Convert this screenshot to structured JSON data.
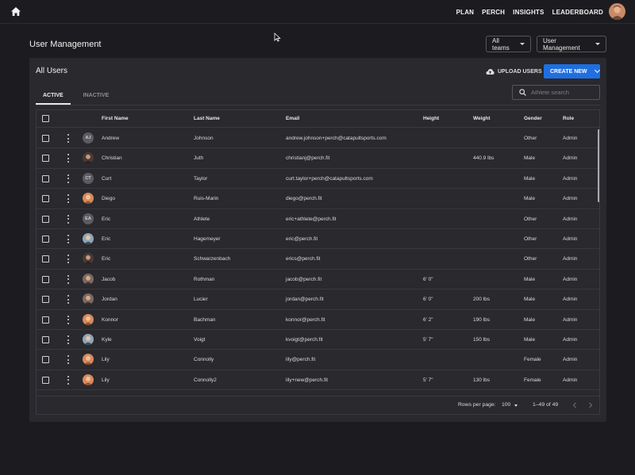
{
  "topbar": {
    "nav": [
      "PLAN",
      "PERCH",
      "INSIGHTS",
      "LEADERBOARD"
    ],
    "home_icon": "home-icon",
    "avatar": "user-avatar"
  },
  "page": {
    "title": "User Management",
    "team_select": "All teams",
    "section_select": "User Management"
  },
  "card": {
    "title": "All Users",
    "upload_label": "UPLOAD USERS",
    "create_label": "CREATE NEW",
    "tabs": [
      "ACTIVE",
      "INACTIVE"
    ],
    "search_placeholder": "Athlete search"
  },
  "table": {
    "columns": [
      "First Name",
      "Last Name",
      "Email",
      "Height",
      "Weight",
      "Gender",
      "Role"
    ],
    "rows": [
      {
        "initials": "AJ",
        "avatar": "initials",
        "first": "Andrew",
        "last": "Johnson",
        "email": "andrew.johnson+perch@catapultsports.com",
        "height": "",
        "weight": "",
        "gender": "Other",
        "role": "Admin"
      },
      {
        "initials": "",
        "avatar": "photo-dark",
        "first": "Christian",
        "last": "Juth",
        "email": "christianj@perch.fit",
        "height": "",
        "weight": "440.9 lbs",
        "gender": "Male",
        "role": "Admin"
      },
      {
        "initials": "CT",
        "avatar": "initials",
        "first": "Curt",
        "last": "Taylor",
        "email": "curt.taylor+perch@catapultsports.com",
        "height": "",
        "weight": "",
        "gender": "Male",
        "role": "Admin"
      },
      {
        "initials": "",
        "avatar": "photo-warm",
        "first": "Diego",
        "last": "Ruis-Marin",
        "email": "diego@perch.fit",
        "height": "",
        "weight": "",
        "gender": "Male",
        "role": "Admin"
      },
      {
        "initials": "EA",
        "avatar": "initials",
        "first": "Eric",
        "last": "Athlete",
        "email": "eric+athlete@perch.fit",
        "height": "",
        "weight": "",
        "gender": "Other",
        "role": "Admin"
      },
      {
        "initials": "",
        "avatar": "photo-light",
        "first": "Eric",
        "last": "Hagemeyer",
        "email": "eric@perch.fit",
        "height": "",
        "weight": "",
        "gender": "Other",
        "role": "Admin"
      },
      {
        "initials": "",
        "avatar": "photo-dark",
        "first": "Eric",
        "last": "Schwarzenbach",
        "email": "erics@perch.fit",
        "height": "",
        "weight": "",
        "gender": "Other",
        "role": "Admin"
      },
      {
        "initials": "",
        "avatar": "photo-mid",
        "first": "Jacob",
        "last": "Rothman",
        "email": "jacob@perch.fit",
        "height": "6' 0\"",
        "weight": "",
        "gender": "Male",
        "role": "Admin"
      },
      {
        "initials": "",
        "avatar": "photo-mid",
        "first": "Jordan",
        "last": "Lucier",
        "email": "jordan@perch.fit",
        "height": "6' 0\"",
        "weight": "200 lbs",
        "gender": "Male",
        "role": "Admin"
      },
      {
        "initials": "",
        "avatar": "photo-warm",
        "first": "Konnor",
        "last": "Bachman",
        "email": "konnor@perch.fit",
        "height": "6' 2\"",
        "weight": "190 lbs",
        "gender": "Male",
        "role": "Admin"
      },
      {
        "initials": "",
        "avatar": "photo-light",
        "first": "Kyle",
        "last": "Voigt",
        "email": "kvoigt@perch.fit",
        "height": "5' 7\"",
        "weight": "150 lbs",
        "gender": "Male",
        "role": "Admin"
      },
      {
        "initials": "",
        "avatar": "photo-warm",
        "first": "Lily",
        "last": "Connolly",
        "email": "lily@perch.fit",
        "height": "",
        "weight": "",
        "gender": "Female",
        "role": "Admin"
      },
      {
        "initials": "",
        "avatar": "photo-warm",
        "first": "Lily",
        "last": "Connolly2",
        "email": "lily+new@perch.fit",
        "height": "5' 7\"",
        "weight": "130 lbs",
        "gender": "Female",
        "role": "Admin"
      }
    ]
  },
  "footer": {
    "rows_per_page_label": "Rows per page:",
    "rows_per_page_value": "100",
    "range": "1–49 of 49"
  },
  "colors": {
    "background": "#1c1c20",
    "card": "#29292e",
    "accent": "#1f6fe0"
  }
}
